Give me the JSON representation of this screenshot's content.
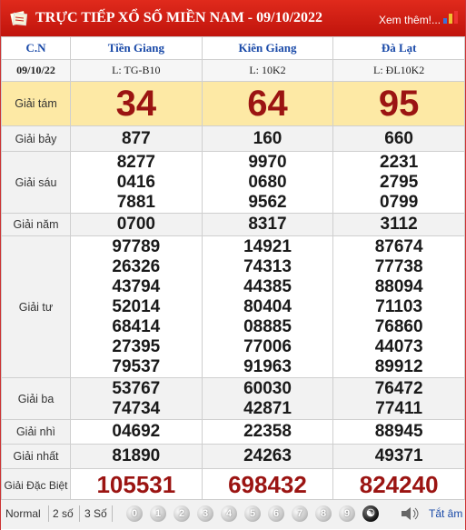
{
  "header": {
    "title": "TRỰC TIẾP XỔ SỐ MIỀN NAM - 09/10/2022",
    "more": "Xem thêm!..."
  },
  "columns": {
    "cn": "C.N",
    "provinces": [
      "Tiền Giang",
      "Kiên Giang",
      "Đà Lạt"
    ]
  },
  "tickets": {
    "date": "09/10/22",
    "codes": [
      "L: TG-B10",
      "L: 10K2",
      "L: ĐL10K2"
    ]
  },
  "prizes": {
    "g8": {
      "label": "Giải tám",
      "values": [
        "34",
        "64",
        "95"
      ]
    },
    "g7": {
      "label": "Giải bảy",
      "values": [
        "877",
        "160",
        "660"
      ]
    },
    "g6": {
      "label": "Giải sáu",
      "values": [
        [
          "8277",
          "0416",
          "7881"
        ],
        [
          "9970",
          "0680",
          "9562"
        ],
        [
          "2231",
          "2795",
          "0799"
        ]
      ]
    },
    "g5": {
      "label": "Giải năm",
      "values": [
        "0700",
        "8317",
        "3112"
      ]
    },
    "g4": {
      "label": "Giải tư",
      "values": [
        [
          "97789",
          "26326",
          "43794",
          "52014",
          "68414",
          "27395",
          "79537"
        ],
        [
          "14921",
          "74313",
          "44385",
          "80404",
          "08885",
          "77006",
          "91963"
        ],
        [
          "87674",
          "77738",
          "88094",
          "71103",
          "76860",
          "44073",
          "89912"
        ]
      ]
    },
    "g3": {
      "label": "Giải ba",
      "values": [
        [
          "53767",
          "74734"
        ],
        [
          "60030",
          "42871"
        ],
        [
          "76472",
          "77411"
        ]
      ]
    },
    "g2": {
      "label": "Giải nhì",
      "values": [
        "04692",
        "22358",
        "88945"
      ]
    },
    "g1": {
      "label": "Giải nhất",
      "values": [
        "81890",
        "24263",
        "49371"
      ]
    },
    "db": {
      "label": "Giải Đặc Biệt",
      "values": [
        "105531",
        "698432",
        "824240"
      ]
    }
  },
  "toolbar": {
    "normal": "Normal",
    "two": "2 số",
    "three": "3 Số",
    "digits": [
      "0",
      "1",
      "2",
      "3",
      "4",
      "5",
      "6",
      "7",
      "8",
      "9"
    ],
    "mute": "Tắt âm"
  }
}
